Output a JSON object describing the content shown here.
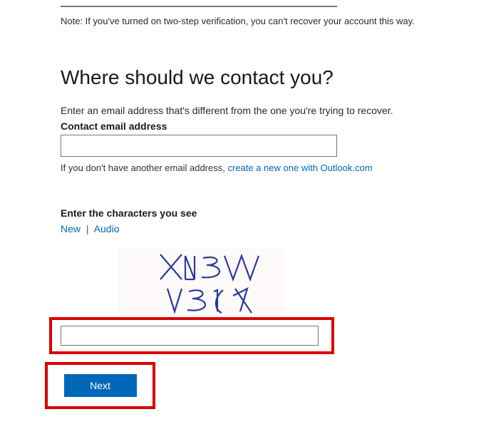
{
  "note": "Note: If you've turned on two-step verification, you can't recover your account this way.",
  "heading": "Where should we contact you?",
  "instruction": "Enter an email address that's different from the one you're trying to recover.",
  "email_label": "Contact email address",
  "help_prefix": "If you don't have another email address, ",
  "help_link": "create a new one with Outlook.com",
  "captcha_label": "Enter the characters you see",
  "captcha_new": "New",
  "captcha_sep": "|",
  "captcha_audio": "Audio",
  "next_button": "Next"
}
